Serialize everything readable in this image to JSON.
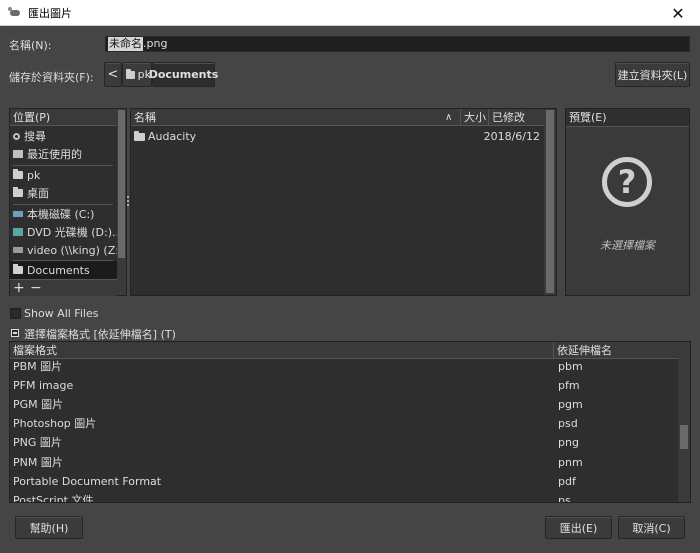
{
  "window": {
    "title": "匯出圖片",
    "close_glyph": "✕"
  },
  "name_field": {
    "label": "名稱(N):",
    "value_selected": "未命名",
    "value_ext": ".png"
  },
  "save_in": {
    "label": "儲存於資料夾(F):",
    "back_glyph": "<",
    "crumbs": [
      "pk",
      "Documents"
    ],
    "new_folder_label": "建立資料夾(L)"
  },
  "places": {
    "header": "位置(P)",
    "items": [
      {
        "label": "搜尋",
        "icon": "search-icon"
      },
      {
        "label": "最近使用的",
        "icon": "recent-icon"
      },
      {
        "label": "pk",
        "icon": "folder-icon"
      },
      {
        "label": "桌面",
        "icon": "folder-icon"
      },
      {
        "label": "本機磁碟 (C:)",
        "icon": "drive-icon"
      },
      {
        "label": "DVD 光碟機 (D:)...",
        "icon": "dvd-icon"
      },
      {
        "label": "video (\\\\king) (Z:)",
        "icon": "network-drive-icon"
      },
      {
        "label": "Documents",
        "icon": "folder-icon"
      }
    ],
    "add_glyph": "+",
    "remove_glyph": "−"
  },
  "files": {
    "columns": {
      "name": "名稱",
      "size": "大小",
      "modified": "已修改"
    },
    "sort_glyph": "∧",
    "rows": [
      {
        "name": "Audacity",
        "size": "",
        "modified": "2018/6/12"
      }
    ]
  },
  "preview": {
    "header": "預覽(E)",
    "icon_glyph": "?",
    "empty_text": "未選擇檔案"
  },
  "show_all_files": {
    "label": "Show All Files",
    "checked": false
  },
  "file_type": {
    "label": "選擇檔案格式 [依延伸檔名] (T)",
    "columns": {
      "format": "檔案格式",
      "ext": "依延伸檔名"
    },
    "rows": [
      {
        "format": "PBM 圖片",
        "ext": "pbm"
      },
      {
        "format": "PFM image",
        "ext": "pfm"
      },
      {
        "format": "PGM 圖片",
        "ext": "pgm"
      },
      {
        "format": "Photoshop 圖片",
        "ext": "psd"
      },
      {
        "format": "PNG 圖片",
        "ext": "png"
      },
      {
        "format": "PNM 圖片",
        "ext": "pnm"
      },
      {
        "format": "Portable Document Format",
        "ext": "pdf"
      },
      {
        "format": "PostScript 文件",
        "ext": "ps"
      }
    ]
  },
  "buttons": {
    "help": "幫助(H)",
    "export": "匯出(E)",
    "cancel": "取消(C)"
  }
}
